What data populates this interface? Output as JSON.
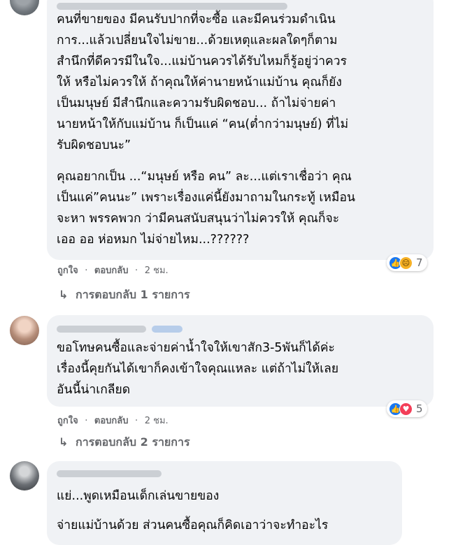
{
  "comments": [
    {
      "paragraphs": [
        [
          "คนที่ขายของ มีคนรับปากที่จะซื้อ และมีคนร่วมดำเนิน",
          "การ...แล้วเปลี่ยนใจไม่ขาย...ด้วยเหตุและผลใดๆก็ตาม",
          "สำนึกที่ดีควรมีในใจ...แม่บ้านควรได้รับไหมก็รู้อยู่ว่าควร",
          "ให้ หรือไม่ควรให้ ถ้าคุณให้ค่านายหน้าแม่บ้าน คุณก็ยัง",
          "เป็นมนุษย์ มีสำนึกและความรับผิดชอบ... ถ้าไม่จ่ายค่า",
          "นายหน้าให้กับแม่บ้าน ก็เป็นแค่ “คน(ต่ำกว่ามนุษย์) ที่ไม่",
          "รับผิดชอบนะ”"
        ],
        [
          "คุณอยากเป็น ...“มนุษย์ หรือ คน” ละ...แต่เราเชื่อว่า คุณ",
          "เป็นแค่”คนนะ” เพราะเรื่องแค่นี้ยังมาถามในกระทู้ เหมือน",
          "จะหา พรรคพวก ว่ามีคนสนับสนุนว่าไม่ควรให้ คุณก็จะ",
          "เออ ออ ห่อหมก ไม่จ่ายไหม...??????"
        ]
      ],
      "reactions": {
        "icons": [
          "like-icon",
          "sad-icon"
        ],
        "count": "7"
      },
      "meta": {
        "like": "ถูกใจ",
        "reply": "ตอบกลับ",
        "time": "2 ชม."
      },
      "replies_label": "การตอบกลับ 1 รายการ"
    },
    {
      "paragraphs": [
        [
          "ขอโทษคนซื้อและจ่ายค่าน้ำใจให้เขาสัก3-5พันก็ได้ค่ะ",
          "เรื่องนี้คุยกันได้เขาก็คงเข้าใจคุณแหละ แต่ถ้าไม่ให้เลย",
          "อันนี้น่าเกลียด"
        ]
      ],
      "reactions": {
        "icons": [
          "like-icon",
          "love-icon"
        ],
        "count": "5"
      },
      "meta": {
        "like": "ถูกใจ",
        "reply": "ตอบกลับ",
        "time": "2 ชม."
      },
      "replies_label": "การตอบกลับ 2 รายการ"
    },
    {
      "paragraphs": [
        [
          "แย่...พูดเหมือนเด็กเล่นขายของ"
        ],
        [
          "จ่ายแม่บ้านด้วย ส่วนคนซื้อคุณก็คิดเอาว่าจะทำอะไร"
        ]
      ]
    }
  ],
  "separator": "·",
  "reply_arrow": "↳",
  "colors": {
    "bubble": "#f0f2f5",
    "meta_text": "#65676b",
    "like": "#1877f2",
    "love": "#f33e58",
    "sad": "#f7b125"
  }
}
